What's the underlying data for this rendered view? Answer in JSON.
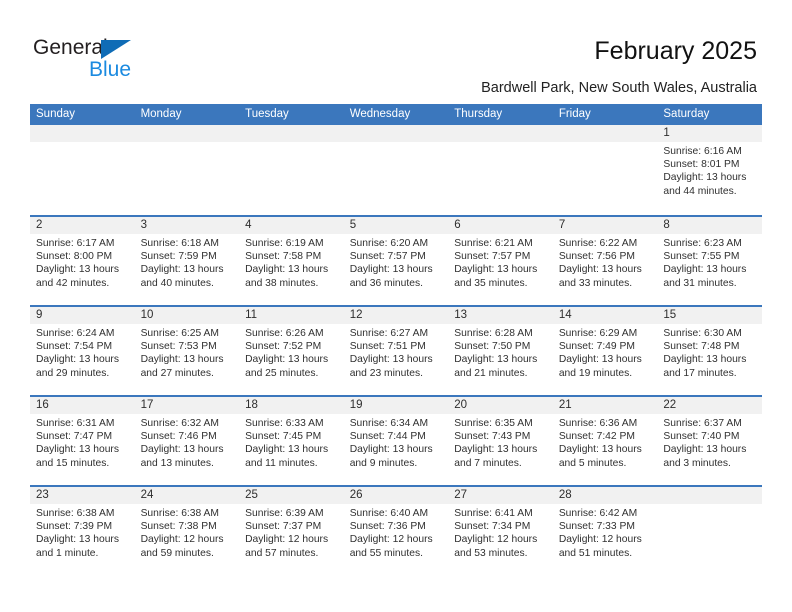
{
  "brand": {
    "name_part1": "General",
    "name_part2": "Blue",
    "accent_color": "#0f6cb6",
    "accent_color_light": "#1b8ae0"
  },
  "header": {
    "title": "February 2025",
    "subtitle": "Bardwell Park, New South Wales, Australia",
    "header_bg_color": "#3b77bd",
    "row_band_color": "#f1f1f1"
  },
  "calendar": {
    "weekdays": [
      "Sunday",
      "Monday",
      "Tuesday",
      "Wednesday",
      "Thursday",
      "Friday",
      "Saturday"
    ],
    "labels": {
      "sunrise": "Sunrise:",
      "sunset": "Sunset:",
      "daylight": "Daylight:"
    },
    "weeks": [
      [
        {
          "day": "",
          "empty": true
        },
        {
          "day": "",
          "empty": true
        },
        {
          "day": "",
          "empty": true
        },
        {
          "day": "",
          "empty": true
        },
        {
          "day": "",
          "empty": true
        },
        {
          "day": "",
          "empty": true
        },
        {
          "day": "1",
          "sunrise": "Sunrise: 6:16 AM",
          "sunset": "Sunset: 8:01 PM",
          "daylight_l1": "Daylight: 13 hours",
          "daylight_l2": "and 44 minutes."
        }
      ],
      [
        {
          "day": "2",
          "sunrise": "Sunrise: 6:17 AM",
          "sunset": "Sunset: 8:00 PM",
          "daylight_l1": "Daylight: 13 hours",
          "daylight_l2": "and 42 minutes."
        },
        {
          "day": "3",
          "sunrise": "Sunrise: 6:18 AM",
          "sunset": "Sunset: 7:59 PM",
          "daylight_l1": "Daylight: 13 hours",
          "daylight_l2": "and 40 minutes."
        },
        {
          "day": "4",
          "sunrise": "Sunrise: 6:19 AM",
          "sunset": "Sunset: 7:58 PM",
          "daylight_l1": "Daylight: 13 hours",
          "daylight_l2": "and 38 minutes."
        },
        {
          "day": "5",
          "sunrise": "Sunrise: 6:20 AM",
          "sunset": "Sunset: 7:57 PM",
          "daylight_l1": "Daylight: 13 hours",
          "daylight_l2": "and 36 minutes."
        },
        {
          "day": "6",
          "sunrise": "Sunrise: 6:21 AM",
          "sunset": "Sunset: 7:57 PM",
          "daylight_l1": "Daylight: 13 hours",
          "daylight_l2": "and 35 minutes."
        },
        {
          "day": "7",
          "sunrise": "Sunrise: 6:22 AM",
          "sunset": "Sunset: 7:56 PM",
          "daylight_l1": "Daylight: 13 hours",
          "daylight_l2": "and 33 minutes."
        },
        {
          "day": "8",
          "sunrise": "Sunrise: 6:23 AM",
          "sunset": "Sunset: 7:55 PM",
          "daylight_l1": "Daylight: 13 hours",
          "daylight_l2": "and 31 minutes."
        }
      ],
      [
        {
          "day": "9",
          "sunrise": "Sunrise: 6:24 AM",
          "sunset": "Sunset: 7:54 PM",
          "daylight_l1": "Daylight: 13 hours",
          "daylight_l2": "and 29 minutes."
        },
        {
          "day": "10",
          "sunrise": "Sunrise: 6:25 AM",
          "sunset": "Sunset: 7:53 PM",
          "daylight_l1": "Daylight: 13 hours",
          "daylight_l2": "and 27 minutes."
        },
        {
          "day": "11",
          "sunrise": "Sunrise: 6:26 AM",
          "sunset": "Sunset: 7:52 PM",
          "daylight_l1": "Daylight: 13 hours",
          "daylight_l2": "and 25 minutes."
        },
        {
          "day": "12",
          "sunrise": "Sunrise: 6:27 AM",
          "sunset": "Sunset: 7:51 PM",
          "daylight_l1": "Daylight: 13 hours",
          "daylight_l2": "and 23 minutes."
        },
        {
          "day": "13",
          "sunrise": "Sunrise: 6:28 AM",
          "sunset": "Sunset: 7:50 PM",
          "daylight_l1": "Daylight: 13 hours",
          "daylight_l2": "and 21 minutes."
        },
        {
          "day": "14",
          "sunrise": "Sunrise: 6:29 AM",
          "sunset": "Sunset: 7:49 PM",
          "daylight_l1": "Daylight: 13 hours",
          "daylight_l2": "and 19 minutes."
        },
        {
          "day": "15",
          "sunrise": "Sunrise: 6:30 AM",
          "sunset": "Sunset: 7:48 PM",
          "daylight_l1": "Daylight: 13 hours",
          "daylight_l2": "and 17 minutes."
        }
      ],
      [
        {
          "day": "16",
          "sunrise": "Sunrise: 6:31 AM",
          "sunset": "Sunset: 7:47 PM",
          "daylight_l1": "Daylight: 13 hours",
          "daylight_l2": "and 15 minutes."
        },
        {
          "day": "17",
          "sunrise": "Sunrise: 6:32 AM",
          "sunset": "Sunset: 7:46 PM",
          "daylight_l1": "Daylight: 13 hours",
          "daylight_l2": "and 13 minutes."
        },
        {
          "day": "18",
          "sunrise": "Sunrise: 6:33 AM",
          "sunset": "Sunset: 7:45 PM",
          "daylight_l1": "Daylight: 13 hours",
          "daylight_l2": "and 11 minutes."
        },
        {
          "day": "19",
          "sunrise": "Sunrise: 6:34 AM",
          "sunset": "Sunset: 7:44 PM",
          "daylight_l1": "Daylight: 13 hours",
          "daylight_l2": "and 9 minutes."
        },
        {
          "day": "20",
          "sunrise": "Sunrise: 6:35 AM",
          "sunset": "Sunset: 7:43 PM",
          "daylight_l1": "Daylight: 13 hours",
          "daylight_l2": "and 7 minutes."
        },
        {
          "day": "21",
          "sunrise": "Sunrise: 6:36 AM",
          "sunset": "Sunset: 7:42 PM",
          "daylight_l1": "Daylight: 13 hours",
          "daylight_l2": "and 5 minutes."
        },
        {
          "day": "22",
          "sunrise": "Sunrise: 6:37 AM",
          "sunset": "Sunset: 7:40 PM",
          "daylight_l1": "Daylight: 13 hours",
          "daylight_l2": "and 3 minutes."
        }
      ],
      [
        {
          "day": "23",
          "sunrise": "Sunrise: 6:38 AM",
          "sunset": "Sunset: 7:39 PM",
          "daylight_l1": "Daylight: 13 hours",
          "daylight_l2": "and 1 minute."
        },
        {
          "day": "24",
          "sunrise": "Sunrise: 6:38 AM",
          "sunset": "Sunset: 7:38 PM",
          "daylight_l1": "Daylight: 12 hours",
          "daylight_l2": "and 59 minutes."
        },
        {
          "day": "25",
          "sunrise": "Sunrise: 6:39 AM",
          "sunset": "Sunset: 7:37 PM",
          "daylight_l1": "Daylight: 12 hours",
          "daylight_l2": "and 57 minutes."
        },
        {
          "day": "26",
          "sunrise": "Sunrise: 6:40 AM",
          "sunset": "Sunset: 7:36 PM",
          "daylight_l1": "Daylight: 12 hours",
          "daylight_l2": "and 55 minutes."
        },
        {
          "day": "27",
          "sunrise": "Sunrise: 6:41 AM",
          "sunset": "Sunset: 7:34 PM",
          "daylight_l1": "Daylight: 12 hours",
          "daylight_l2": "and 53 minutes."
        },
        {
          "day": "28",
          "sunrise": "Sunrise: 6:42 AM",
          "sunset": "Sunset: 7:33 PM",
          "daylight_l1": "Daylight: 12 hours",
          "daylight_l2": "and 51 minutes."
        },
        {
          "day": "",
          "empty": true
        }
      ]
    ]
  }
}
